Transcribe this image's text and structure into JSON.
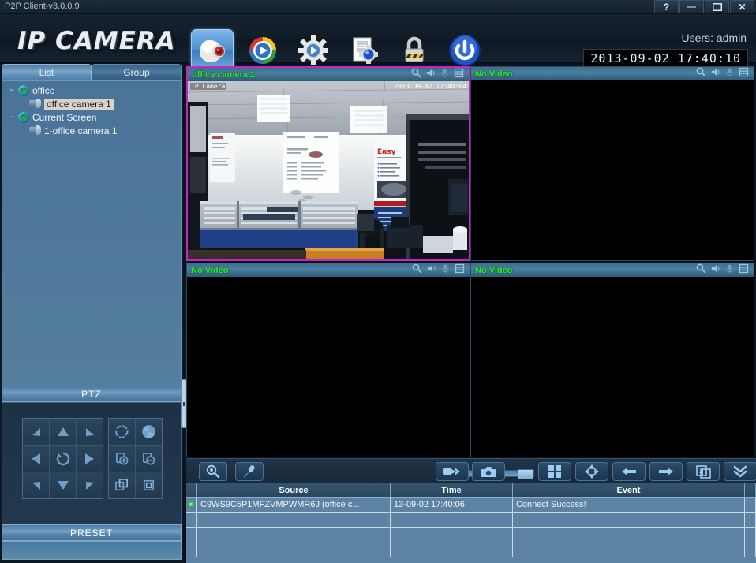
{
  "window": {
    "title": "P2P Client-v3.0.0.9",
    "buttons": {
      "help": "?",
      "minimize": "—",
      "maximize": "❐",
      "close": "✕"
    }
  },
  "header": {
    "logo": "IP CAMERA",
    "users": "Users: admin",
    "datetime": "2013-09-02 17:40:10",
    "toolbar": [
      {
        "name": "camera-icon",
        "label": "Camera",
        "active": true
      },
      {
        "name": "playback-icon",
        "label": "Playback",
        "active": false
      },
      {
        "name": "settings-gear-icon",
        "label": "Settings",
        "active": false
      },
      {
        "name": "log-config-icon",
        "label": "Log",
        "active": false
      },
      {
        "name": "lock-icon",
        "label": "Lock",
        "active": false
      },
      {
        "name": "power-icon",
        "label": "Power",
        "active": false
      }
    ]
  },
  "sidebar": {
    "tabs": [
      {
        "label": "List",
        "active": true
      },
      {
        "label": "Group",
        "active": false
      }
    ],
    "tree": [
      {
        "level": 1,
        "expander": "-",
        "icon": "globe-icon",
        "label": "office",
        "selected": false
      },
      {
        "level": 2,
        "expander": "",
        "icon": "camera-node-icon",
        "label": "office camera 1",
        "selected": true
      },
      {
        "level": 1,
        "expander": "-",
        "icon": "globe-icon",
        "label": "Current Screen",
        "selected": false
      },
      {
        "level": 2,
        "expander": "",
        "icon": "camera-node-icon",
        "label": "1-office camera 1",
        "selected": false
      }
    ],
    "ptz": {
      "title": "PTZ",
      "dpad": [
        {
          "name": "ptz-up-left",
          "glyph": "►",
          "rot": 225
        },
        {
          "name": "ptz-up",
          "glyph": "▲",
          "rot": 0
        },
        {
          "name": "ptz-up-right",
          "glyph": "◄",
          "rot": 135
        },
        {
          "name": "ptz-left",
          "glyph": "◄",
          "rot": 0
        },
        {
          "name": "ptz-auto-scan",
          "glyph": "↻",
          "rot": 0
        },
        {
          "name": "ptz-right",
          "glyph": "►",
          "rot": 0
        },
        {
          "name": "ptz-down-left",
          "glyph": "▲",
          "rot": 225
        },
        {
          "name": "ptz-down",
          "glyph": "▼",
          "rot": 0
        },
        {
          "name": "ptz-down-right",
          "glyph": "▲",
          "rot": 135
        }
      ],
      "fpad": [
        {
          "name": "iris-open-icon",
          "glyph": "◌"
        },
        {
          "name": "iris-close-icon",
          "glyph": "◕"
        },
        {
          "name": "focus-near-icon",
          "glyph": "⊕"
        },
        {
          "name": "focus-far-icon",
          "glyph": "⊖"
        },
        {
          "name": "zoom-in-icon",
          "glyph": "⧉"
        },
        {
          "name": "zoom-out-icon",
          "glyph": "▣"
        }
      ]
    },
    "preset": {
      "title": "PRESET"
    }
  },
  "video": {
    "panels": [
      {
        "title": "office camera 1",
        "selected": true,
        "has_video": true,
        "osd_left": "IP Camera",
        "osd_right": "2013-09-02 17:40:04",
        "icons": [
          "ptz-zoom-icon",
          "audio-speaker-icon",
          "microphone-icon",
          "record-frames-icon"
        ]
      },
      {
        "title": "No Video",
        "selected": false,
        "has_video": false,
        "osd_left": "",
        "osd_right": "",
        "icons": [
          "ptz-zoom-icon",
          "audio-speaker-icon",
          "microphone-icon",
          "record-frames-icon"
        ]
      },
      {
        "title": "No Video",
        "selected": false,
        "has_video": false,
        "osd_left": "",
        "osd_right": "",
        "icons": [
          "ptz-zoom-icon",
          "audio-speaker-icon",
          "microphone-icon",
          "record-frames-icon"
        ]
      },
      {
        "title": "No Video",
        "selected": false,
        "has_video": false,
        "osd_left": "",
        "osd_right": "",
        "icons": [
          "ptz-zoom-icon",
          "audio-speaker-icon",
          "microphone-icon",
          "record-frames-icon"
        ]
      }
    ]
  },
  "bottom_toolbar": {
    "volume_muted": true,
    "volume_percent": 80,
    "buttons": [
      {
        "name": "digital-zoom-button",
        "icon": "magnifier-icon"
      },
      {
        "name": "talk-microphone-button",
        "icon": "microphone-icon"
      },
      {
        "name": "manual-record-button",
        "icon": "video-record-icon"
      },
      {
        "name": "snapshot-button",
        "icon": "camera-snapshot-icon"
      },
      {
        "name": "layout-quad-button",
        "icon": "grid-four-icon"
      },
      {
        "name": "fullscreen-button",
        "icon": "expand-arrows-icon"
      },
      {
        "name": "previous-page-button",
        "icon": "arrow-left-icon"
      },
      {
        "name": "next-page-button",
        "icon": "arrow-right-icon"
      },
      {
        "name": "tour-cycle-button",
        "icon": "cycle-swap-icon"
      },
      {
        "name": "collapse-panel-button",
        "icon": "double-chevron-down-icon"
      }
    ]
  },
  "event_log": {
    "columns": [
      "",
      "Source",
      "Time",
      "Event",
      ""
    ],
    "rows": [
      {
        "status": "connected",
        "source": "C9WS9C5P1MFZVMPWMR6J (office c...",
        "time": "13-09-02 17:40:06",
        "event": "Connect Success!",
        "extra": ""
      }
    ],
    "empty_rows": 3
  },
  "colors": {
    "accent": "#4f86b8",
    "selection_border": "#c724c7",
    "title_green": "#22ee22",
    "status_dot": "#17c217",
    "panel_bg": "#5c83a4"
  }
}
